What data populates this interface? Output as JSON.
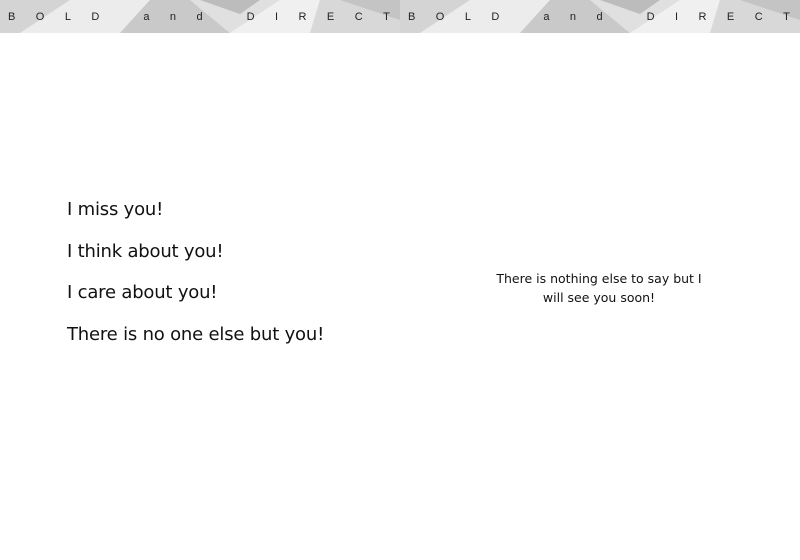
{
  "banner": {
    "letters": [
      "B",
      "O",
      "L",
      "D",
      "a",
      "n",
      "d",
      "D",
      "I",
      "R",
      "E",
      "C",
      "T"
    ],
    "colors": {
      "base": "#e5e5e5",
      "mid": "#d2d2d2",
      "dark": "#bdbdbd",
      "light": "#efefef"
    }
  },
  "left_lines": [
    "I miss you!",
    "I think about you!",
    "I care about you!",
    "There is no one else but you!"
  ],
  "right_message": {
    "line1": "There is nothing else to say but I",
    "line2": "will see you soon!"
  }
}
